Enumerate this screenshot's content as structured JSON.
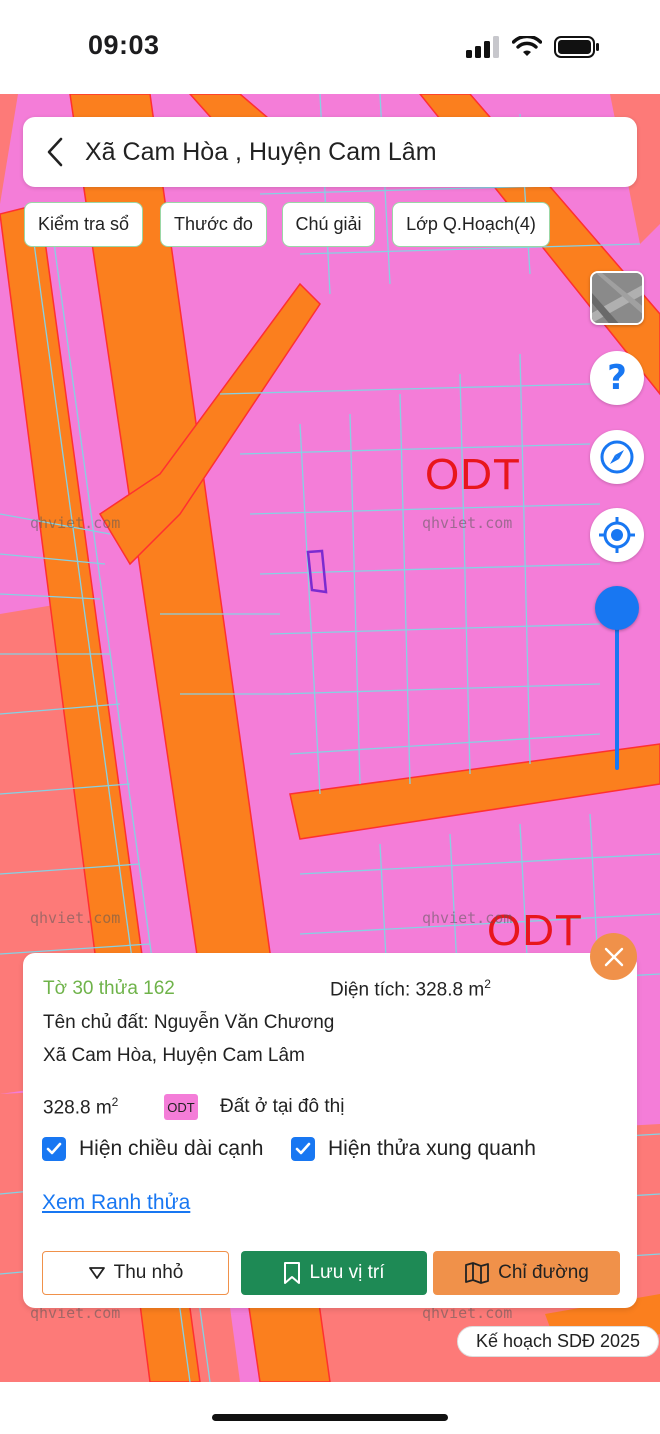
{
  "status_bar": {
    "time": "09:03"
  },
  "header": {
    "title": "Xã Cam Hòa , Huyện Cam Lâm"
  },
  "chips": [
    "Kiểm tra sổ",
    "Thước đo",
    "Chú giải",
    "Lớp Q.Hoạch(4)"
  ],
  "map": {
    "zone_labels": [
      "ODT",
      "ODT"
    ],
    "watermark": "qhviet.com",
    "colors": {
      "residential": "#f47dd8",
      "road": "#fb7f1e",
      "border": "#ff7b80",
      "parcel_lines": "#86d1e3",
      "selected_parcel": "#7b2bd0"
    }
  },
  "map_controls": {
    "help_icon": "question-mark-icon",
    "compass_icon": "compass-icon",
    "locate_icon": "crosshair-icon",
    "zoom_level_fraction": 1.0
  },
  "parcel_card": {
    "parcel_id": "Tờ 30 thửa 162",
    "area_label": "Diện tích: 328.8 m",
    "area_unit_sup": "2",
    "owner": "Tên chủ đất: Nguyễn Văn Chương",
    "address": "Xã Cam Hòa, Huyện Cam Lâm",
    "zone_area": "328.8 m",
    "zone_area_sup": "2",
    "zone_code": "ODT",
    "zone_name": "Đất ở tại đô thị",
    "checkbox_edge_length": {
      "label": "Hiện chiều dài cạnh",
      "checked": true
    },
    "checkbox_neighbors": {
      "label": "Hiện thửa xung quanh",
      "checked": true
    },
    "boundary_link": "Xem Ranh thửa",
    "buttons": {
      "minimize": "Thu nhỏ",
      "save_location": "Lưu vị trí",
      "directions": "Chỉ đường"
    },
    "accent_color": "#f0914a",
    "save_color": "#1e8a55"
  },
  "plan_badge": "Kế hoạch SDĐ 2025"
}
